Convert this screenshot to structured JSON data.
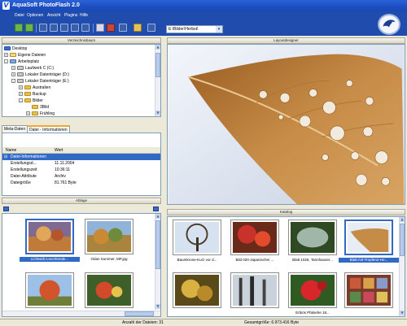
{
  "window": {
    "title": "AquaSoft PhotoFlash 2.0",
    "app_icon_letter": "V"
  },
  "menu": [
    "Datei",
    "Optionen",
    "Ansicht",
    "Plugins",
    "Hilfe"
  ],
  "toolbar": {
    "path_value": "E:\\Bilder\\Herbst\\"
  },
  "panels": {
    "tree_title": "Verzeichnisbaum",
    "preview_title": "Layoutdesigner",
    "ablage_title": "Ablage",
    "katalog_title": "Katalog"
  },
  "tree": [
    {
      "label": "Desktop",
      "icon": "desktop-icon",
      "expander": ""
    },
    {
      "label": "Eigene Dateien",
      "icon": "documents-icon",
      "expander": "+"
    },
    {
      "label": "Arbeitsplatz",
      "icon": "computer-icon",
      "expander": "-"
    },
    {
      "label": "Laufwerk C (C:)",
      "icon": "drive-icon",
      "expander": "+"
    },
    {
      "label": "Lokaler Datenträger (D:)",
      "icon": "drive-icon",
      "expander": "+"
    },
    {
      "label": "Lokaler Datenträger (E:)",
      "icon": "drive-icon",
      "expander": "-"
    },
    {
      "label": "Australien",
      "icon": "folder-icon",
      "expander": "+"
    },
    {
      "label": "Backup",
      "icon": "folder-icon",
      "expander": "+"
    },
    {
      "label": "Bilder",
      "icon": "folder-icon",
      "expander": "-"
    },
    {
      "label": "3Bild",
      "icon": "folder-icon",
      "expander": ""
    },
    {
      "label": "Frühling",
      "icon": "folder-icon",
      "expander": "+"
    }
  ],
  "meta": {
    "tabs": [
      "Meta-Daten",
      "Datei - Informationen"
    ],
    "columns": [
      "Name",
      "Wert"
    ],
    "rows": [
      {
        "name": "Datei-Informationen",
        "value": ""
      },
      {
        "name": "Erstellungsd...",
        "value": "11.11.2004"
      },
      {
        "name": "Erstellungszeit",
        "value": "10:36:11"
      },
      {
        "name": "Datei-Attribute",
        "value": "Archiv"
      },
      {
        "name": "Dateigröße",
        "value": "81.761 Byte"
      }
    ]
  },
  "ablage_items": [
    {
      "caption": "Lichtwirb-Leuchtende..."
    },
    {
      "caption": "Odan Summer, MP.jpg"
    },
    {
      "caption": ""
    },
    {
      "caption": ""
    }
  ],
  "katalog_items": [
    {
      "caption": "Baumkrone-Kurz vor d..."
    },
    {
      "caption": "Bild 020-Japanischer ..."
    },
    {
      "caption": "Blatt 1026, Tannhauser..."
    },
    {
      "caption": "Blatt-mit-Tropfen2-He..."
    },
    {
      "caption": ""
    },
    {
      "caption": ""
    },
    {
      "caption": "Erbiös Pfalsehe 18..."
    },
    {
      "caption": ""
    }
  ],
  "status": {
    "file_count": "Anzahl der Dateien: 31",
    "total_size": "Gesamtgröße: 6.973.416 Byte"
  },
  "colors": {
    "title_blue": "#1d4fc2",
    "toolbar_blue": "#1f4cad",
    "selection": "#316ac5",
    "leaf": "#b8813a"
  }
}
